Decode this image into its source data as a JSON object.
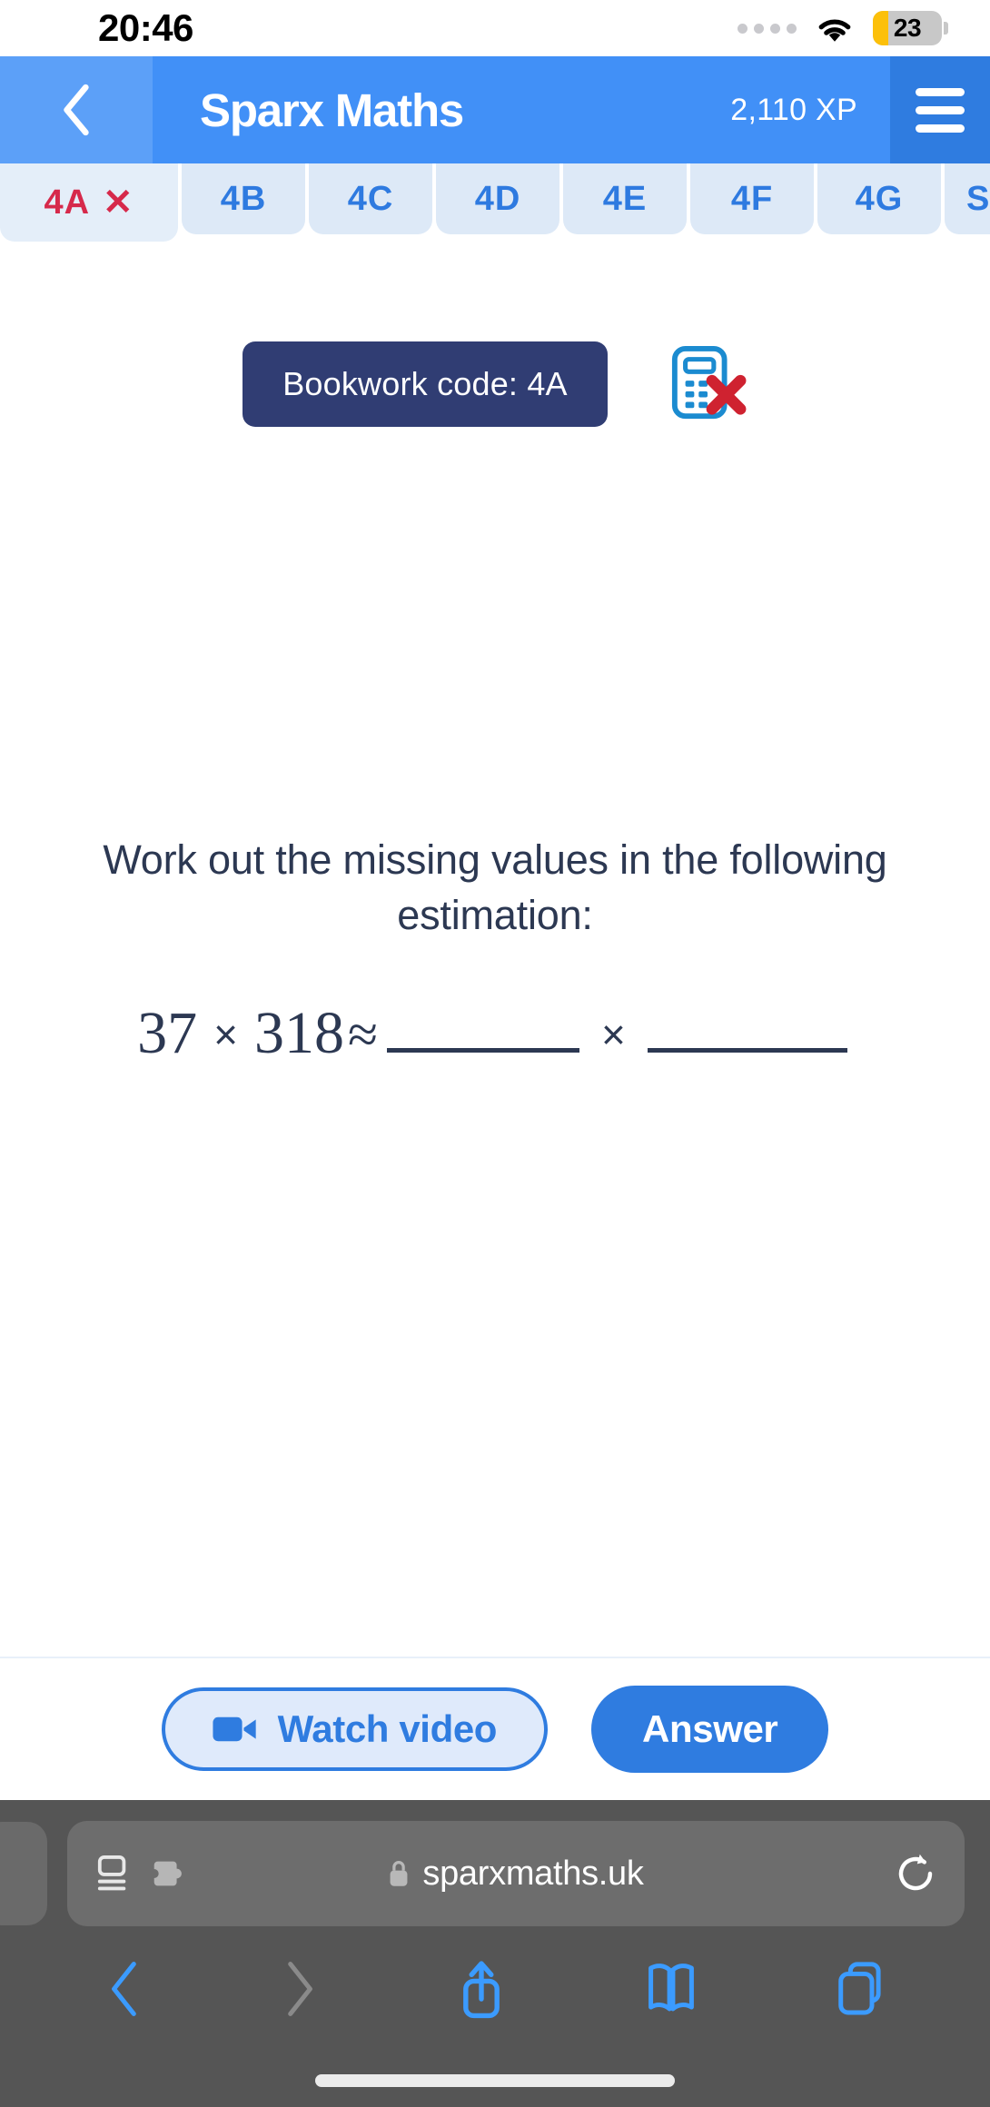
{
  "status_bar": {
    "time": "20:46",
    "battery_level": "23",
    "battery_percent": 23,
    "battery_color": "#fcc00a",
    "wifi_icon": "wifi-icon",
    "signal_icon": "cellular-dots-icon"
  },
  "app_header": {
    "back_icon": "chevron-left-icon",
    "title": "Sparx Maths",
    "xp": "2,110 XP",
    "menu_icon": "hamburger-menu-icon",
    "bg_color": "#4190f7",
    "menu_bg_color": "#2f7ce0"
  },
  "tabs": [
    {
      "label": "4A",
      "state": "active",
      "close_mark": "✕",
      "color": "#d6294b"
    },
    {
      "label": "4B",
      "state": "default",
      "color": "#2e7ae0"
    },
    {
      "label": "4C",
      "state": "default",
      "color": "#2e7ae0"
    },
    {
      "label": "4D",
      "state": "default",
      "color": "#2e7ae0"
    },
    {
      "label": "4E",
      "state": "default",
      "color": "#2e7ae0"
    },
    {
      "label": "4F",
      "state": "default",
      "color": "#2e7ae0"
    },
    {
      "label": "4G",
      "state": "default",
      "color": "#2e7ae0"
    },
    {
      "label": "Su",
      "state": "partial",
      "color": "#2e7ae0"
    }
  ],
  "question_card": {
    "bookwork_code": "Bookwork code: 4A",
    "bookwork_bg": "#303d73",
    "no_calculator_icon": "calculator-forbidden-icon",
    "prompt": "Work out the missing values in the following estimation:",
    "equation": {
      "left_operand": "37",
      "operator_1": "×",
      "right_operand": "318",
      "relation": "≈",
      "blank_1": "",
      "operator_2": "×",
      "blank_2": ""
    }
  },
  "actions": {
    "watch_video_label": "Watch video",
    "watch_video_icon": "video-camera-icon",
    "answer_label": "Answer",
    "answer_bg": "#2f7ce0"
  },
  "browser": {
    "url": "sparxmaths.uk",
    "lock_icon": "lock-icon",
    "reader_icon": "reader-view-icon",
    "extensions_icon": "puzzle-piece-icon",
    "reload_icon": "reload-icon",
    "toolbar": [
      {
        "name": "back",
        "icon": "chevron-left-icon",
        "enabled": true
      },
      {
        "name": "forward",
        "icon": "chevron-right-icon",
        "enabled": false
      },
      {
        "name": "share",
        "icon": "share-icon",
        "enabled": true
      },
      {
        "name": "bookmarks",
        "icon": "book-icon",
        "enabled": true
      },
      {
        "name": "tabs",
        "icon": "tabs-icon",
        "enabled": true
      }
    ]
  }
}
